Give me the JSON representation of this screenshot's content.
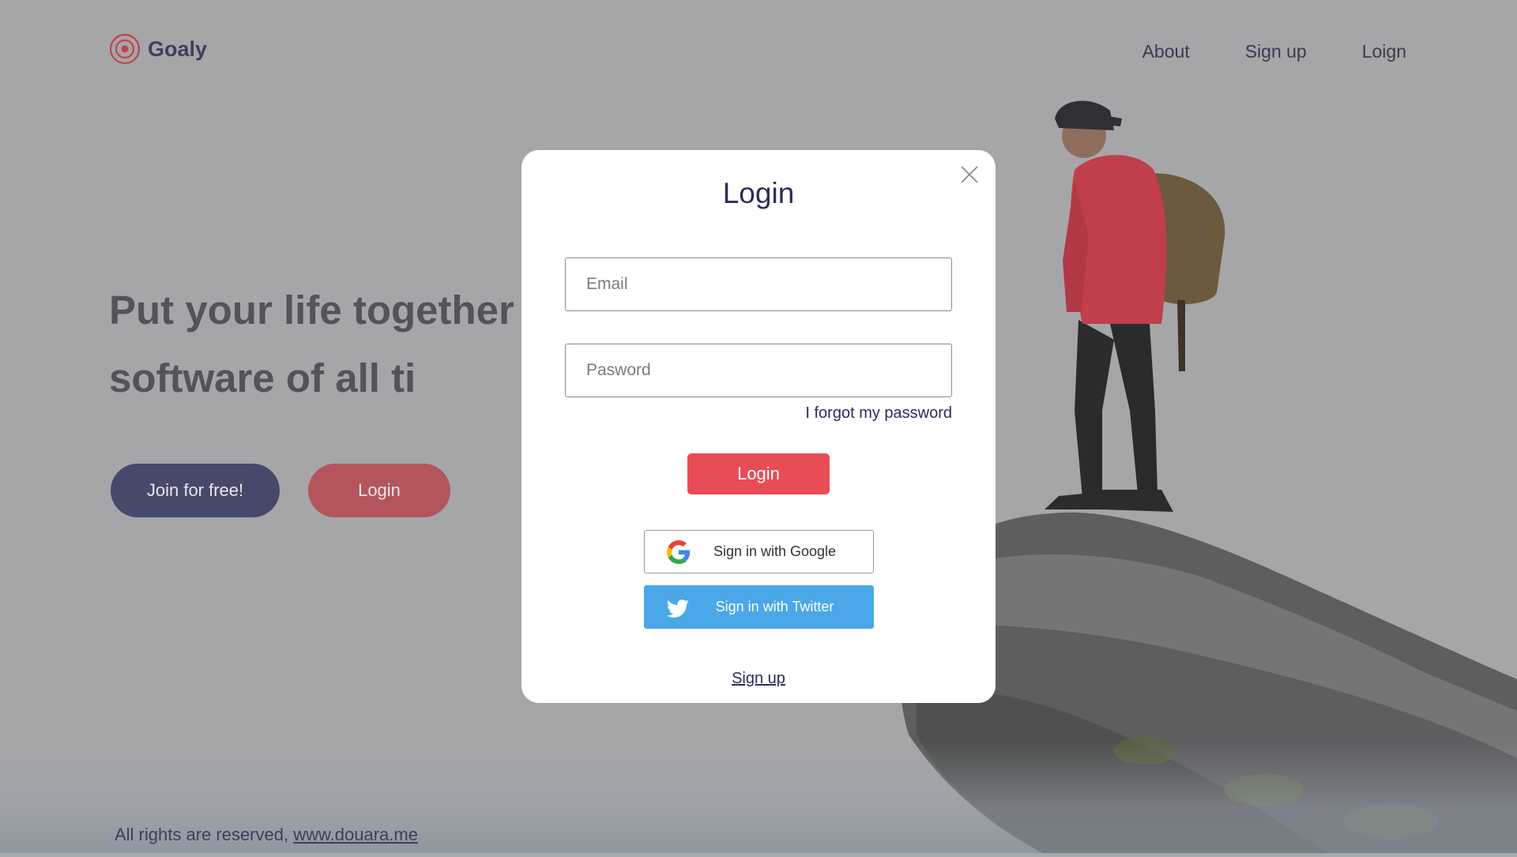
{
  "header": {
    "brand": "Goaly",
    "nav": [
      {
        "label": "About"
      },
      {
        "label": "Sign up"
      },
      {
        "label": "Loign"
      }
    ]
  },
  "hero": {
    "title": "Put your life together w goals software of all ti",
    "join_label": "Join for free!",
    "login_label": "Login"
  },
  "footer": {
    "text": "All rights are reserved, ",
    "link": "www.douara.me"
  },
  "modal": {
    "title": "Login",
    "email_placeholder": "Email",
    "password_placeholder": "Pasword",
    "forgot_label": "I forgot my password",
    "login_label": "Login",
    "google_label": "Sign in with Google",
    "twitter_label": "Sign in with Twitter",
    "signup_label": "Sign up"
  },
  "colors": {
    "brand_navy": "#2b2d5a",
    "accent_red": "#e84c55",
    "twitter_blue": "#4aa7e8",
    "overlay_gray": "#a6a6a8"
  },
  "icons": [
    "logo-target-icon",
    "close-icon",
    "google-icon",
    "twitter-icon"
  ]
}
